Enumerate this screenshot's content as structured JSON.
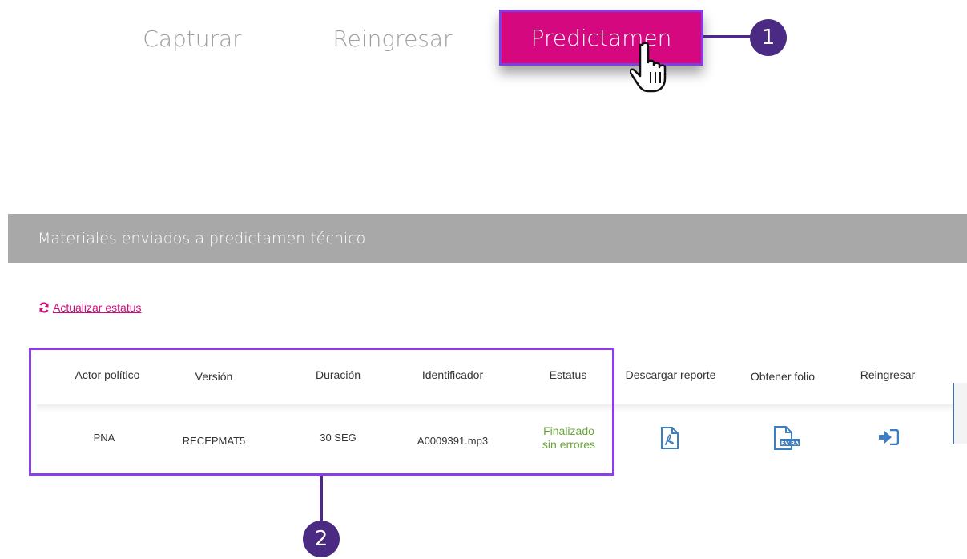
{
  "tabs": {
    "capturar": "Capturar",
    "reingresar": "Reingresar",
    "predictamen": "Predictamen"
  },
  "badges": {
    "one": "1",
    "two": "2"
  },
  "section": {
    "title": "Materiales enviados a predictamen técnico"
  },
  "refresh": {
    "label": "Actualizar estatus"
  },
  "table": {
    "headers": {
      "actor": "Actor político",
      "version": "Versión",
      "duracion": "Duración",
      "identificador": "Identificador",
      "estatus": "Estatus",
      "descargar": "Descargar reporte",
      "folio": "Obtener folio",
      "reingresar": "Reingresar"
    },
    "row": {
      "actor": "PNA",
      "version": "RECEPMAT5",
      "duracion": "30 SEG",
      "identificador": "A0009391.mp3",
      "estatus_line1": "Finalizado",
      "estatus_line2": "sin errores",
      "folio_icon_text": "RV RA"
    }
  },
  "colors": {
    "accent": "#d6087f",
    "highlight": "#8a3fe8",
    "badge": "#4a2a83",
    "status_ok": "#6aa63a",
    "icon_blue": "#3a7fc1"
  },
  "icons": {
    "hand": "pointer-hand-icon",
    "refresh": "refresh-icon",
    "pdf": "pdf-icon",
    "folio": "document-folio-icon",
    "reingresar": "sign-in-icon"
  }
}
